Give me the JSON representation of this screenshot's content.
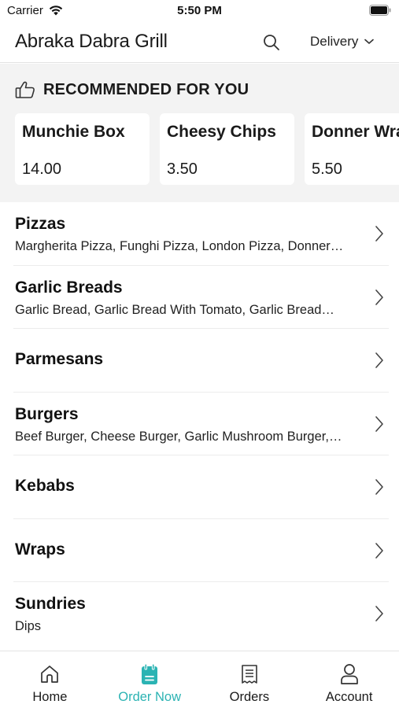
{
  "status_bar": {
    "carrier": "Carrier",
    "time": "5:50 PM",
    "wifi_icon": "wifi-icon",
    "battery_icon": "battery-icon"
  },
  "header": {
    "title": "Abraka Dabra Grill",
    "search_icon": "search-icon",
    "delivery_label": "Delivery",
    "delivery_icon": "chevron-down-icon"
  },
  "recommended": {
    "title": "RECOMMENDED FOR YOU",
    "icon": "thumbs-up-icon",
    "items": [
      {
        "name": "Munchie Box",
        "price": "14.00"
      },
      {
        "name": "Cheesy Chips",
        "price": "3.50"
      },
      {
        "name": "Donner Wrap",
        "price": "5.50"
      }
    ]
  },
  "categories": [
    {
      "name": "Pizzas",
      "items": "Margherita Pizza, Funghi Pizza, London Pizza, Donner…"
    },
    {
      "name": "Garlic Breads",
      "items": "Garlic Bread, Garlic Bread With Tomato, Garlic Bread…"
    },
    {
      "name": "Parmesans",
      "items": ""
    },
    {
      "name": "Burgers",
      "items": "Beef Burger, Cheese Burger, Garlic Mushroom Burger,…"
    },
    {
      "name": "Kebabs",
      "items": ""
    },
    {
      "name": "Wraps",
      "items": ""
    },
    {
      "name": "Sundries",
      "items": "Dips"
    }
  ],
  "tabs": [
    {
      "label": "Home",
      "icon": "home-icon",
      "active": false
    },
    {
      "label": "Order Now",
      "icon": "order-icon",
      "active": true
    },
    {
      "label": "Orders",
      "icon": "receipt-icon",
      "active": false
    },
    {
      "label": "Account",
      "icon": "user-icon",
      "active": false
    }
  ],
  "colors": {
    "accent": "#2bb3b3",
    "section_background": "#f3f3f3"
  }
}
